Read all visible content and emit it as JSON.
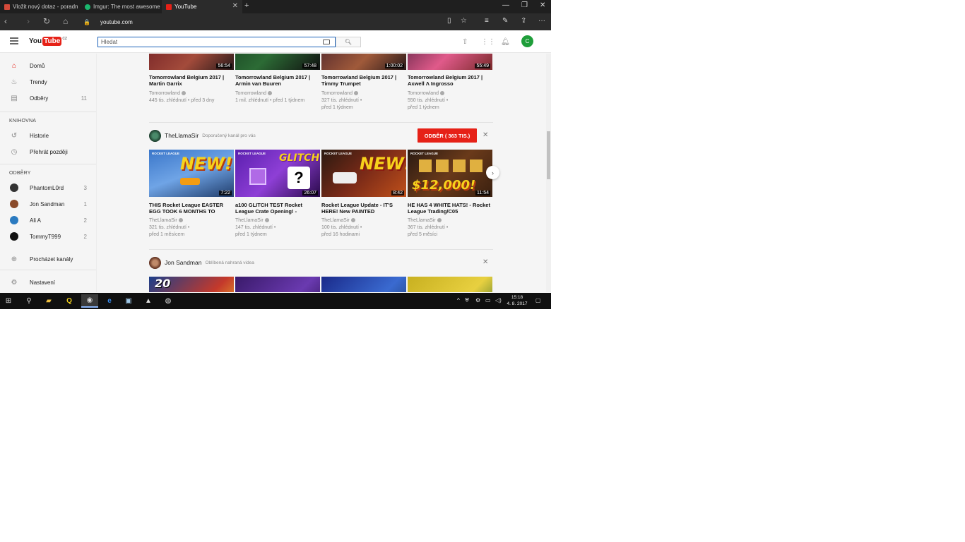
{
  "browser": {
    "tabs": [
      {
        "title": "Vložit nový dotaz - poradn",
        "favicon_color": "#d44a3a"
      },
      {
        "title": "Imgur: The most awesome i",
        "favicon_color": "#1bb76e"
      },
      {
        "title": "YouTube",
        "favicon_color": "#e62117"
      }
    ],
    "new_tab": "+",
    "url": "youtube.com"
  },
  "yt": {
    "logo_you": "You",
    "logo_tube": "Tube",
    "logo_country": "CZ",
    "search_placeholder": "Hledat",
    "avatar_letter": "C"
  },
  "sidebar": {
    "main_items": [
      {
        "label": "Domů",
        "count": ""
      },
      {
        "label": "Trendy",
        "count": ""
      },
      {
        "label": "Odběry",
        "count": "11"
      }
    ],
    "library_heading": "KNIHOVNA",
    "library_items": [
      {
        "label": "Historie"
      },
      {
        "label": "Přehrát později"
      }
    ],
    "subs_heading": "ODBĚRY",
    "subs": [
      {
        "label": "PhantomL0rd",
        "count": "3",
        "color": "#333333"
      },
      {
        "label": "Jon Sandman",
        "count": "1",
        "color": "#8a4a2a"
      },
      {
        "label": "Ali A",
        "count": "2",
        "color": "#2a7ac0"
      },
      {
        "label": "TommyT999",
        "count": "2",
        "color": "#111111"
      }
    ],
    "browse_channels": "Procházet kanály",
    "settings": "Nastavení"
  },
  "shelf1": {
    "videos": [
      {
        "title": "Tomorrowland Belgium 2017 | Martin Garrix",
        "duration": "56:54",
        "channel": "Tomorrowland",
        "meta1": "445 tis. zhlédnutí • před 3 dny",
        "meta2": ""
      },
      {
        "title": "Tomorrowland Belgium 2017 | Armin van Buuren",
        "duration": "57:48",
        "channel": "Tomorrowland",
        "meta1": "1 mil. zhlédnutí • před 1 týdnem",
        "meta2": ""
      },
      {
        "title": "Tomorrowland Belgium 2017 | Timmy Trumpet",
        "duration": "1:00:02",
        "channel": "Tomorrowland",
        "meta1": "327 tis. zhlédnutí •",
        "meta2": "před 1 týdnem"
      },
      {
        "title": "Tomorrowland Belgium 2017 | Axwell Λ Ingrosso",
        "duration": "55:49",
        "channel": "Tomorrowland",
        "meta1": "550 tis. zhlédnutí •",
        "meta2": "před 1 týdnem"
      }
    ]
  },
  "shelf2": {
    "channel": "TheLlamaSir",
    "subtitle": "Doporučený kanál pro vás",
    "subscribe": "ODBĚR ( 363 TIS.)",
    "close": "✕",
    "next": "›",
    "videos": [
      {
        "title": "THIS Rocket League EASTER EGG TOOK 6 MONTHS TO",
        "duration": "7:22",
        "channel": "TheLlamaSir",
        "meta1": "321 tis. zhlédnutí •",
        "meta2": "před 1 měsícem",
        "thumb_text": "NEW!",
        "badge": "ROCKET LEAGUE"
      },
      {
        "title": "a100 GLITCH TEST Rocket League Crate Opening! -",
        "duration": "26:07",
        "channel": "TheLlamaSir",
        "meta1": "147 tis. zhlédnutí •",
        "meta2": "před 1 týdnem",
        "thumb_text": "GLITCH",
        "badge": "ROCKET LEAGUE"
      },
      {
        "title": "Rocket League Update - IT'S HERE! New PAINTED",
        "duration": "8:42",
        "channel": "TheLlamaSir",
        "meta1": "100 tis. zhlédnutí •",
        "meta2": "před 16 hodinami",
        "thumb_text": "NEW!",
        "badge": "ROCKET LEAGUE"
      },
      {
        "title": "HE HAS 4 WHITE HATS! - Rocket League Trading/C05",
        "duration": "11:54",
        "channel": "TheLlamaSir",
        "meta1": "367 tis. zhlédnutí •",
        "meta2": "před 5 měsíci",
        "thumb_text": "$12,000!",
        "badge": "ROCKET LEAGUE"
      }
    ]
  },
  "shelf3": {
    "channel": "Jon Sandman",
    "subtitle": "Oblíbená nahraná videa",
    "close": "✕",
    "thumb_text": "20"
  },
  "taskbar": {
    "time": "15:18",
    "date": "4. 8. 2017"
  },
  "colors": {
    "accent_red": "#e62117",
    "search_border": "#1c62b9"
  }
}
